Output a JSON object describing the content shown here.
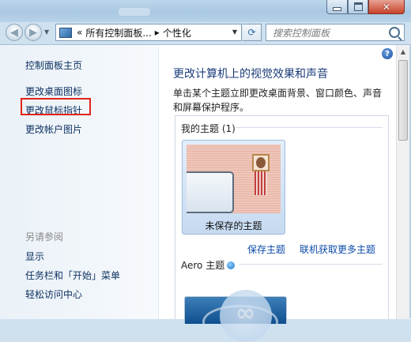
{
  "window": {
    "buttons": {
      "minimize": "–",
      "maximize": "□",
      "close": "✕"
    }
  },
  "address_bar": {
    "chevrons": "«",
    "crumbs": [
      "所有控制面板...",
      "个性化"
    ],
    "separator": "▸",
    "refresh_symbol": "⟳"
  },
  "search": {
    "placeholder": "搜索控制面板"
  },
  "help_label": "?",
  "sidebar": {
    "home": "控制面板主页",
    "links": [
      "更改桌面图标",
      "更改鼠标指针",
      "更改帐户图片"
    ],
    "highlighted_link_index": 1,
    "highlight_color": "#e2231a",
    "see_also_heading": "另请参阅",
    "see_also": [
      "显示",
      "任务栏和「开始」菜单",
      "轻松访问中心"
    ]
  },
  "main": {
    "title": "更改计算机上的视觉效果和声音",
    "description": "单击某个主题立即更改桌面背景、窗口颜色、声音和屏幕保护程序。",
    "my_themes_heading": "我的主题 (1)",
    "unsaved_theme_name": "未保存的主题",
    "save_theme": "保存主题",
    "more_themes": "联机获取更多主题",
    "aero_heading": "Aero 主题"
  },
  "colors": {
    "link": "#0b2f5e",
    "title": "#1a3b7a",
    "accent_link": "#0b4aa8"
  }
}
